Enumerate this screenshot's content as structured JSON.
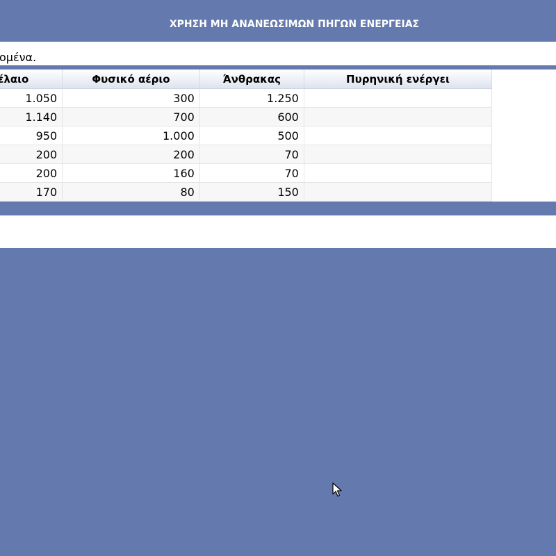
{
  "header": {
    "title": "ΧΡΗΣΗ ΜΗ ΑΝΑΝΕΩΣΙΜΩΝ ΠΗΓΩΝ ΕΝΕΡΓΕΙΑΣ"
  },
  "instruction": {
    "text": "ομένα."
  },
  "table": {
    "columns": [
      "Πετρέλαιο",
      "Φυσικό αέριο",
      "Άνθρακας",
      "Πυρηνική ενέργει"
    ],
    "rows": [
      [
        "1.050",
        "300",
        "1.250",
        ""
      ],
      [
        "1.140",
        "700",
        "600",
        ""
      ],
      [
        "950",
        "1.000",
        "500",
        ""
      ],
      [
        "200",
        "200",
        "70",
        ""
      ],
      [
        "200",
        "160",
        "70",
        ""
      ],
      [
        "170",
        "80",
        "150",
        ""
      ]
    ]
  },
  "colors": {
    "background": "#6479ad",
    "panel": "#ffffff",
    "header_text": "#ffffff"
  },
  "icons": {
    "cursor": "mouse-pointer-icon"
  }
}
